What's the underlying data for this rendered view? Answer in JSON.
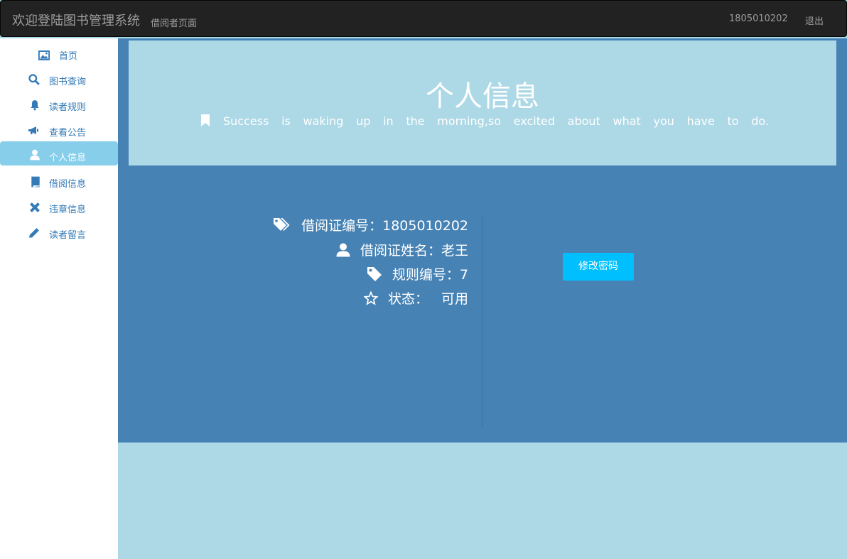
{
  "navbar": {
    "brand": "欢迎登陆图书管理系统",
    "subtitle": "借阅者页面",
    "user": "1805010202",
    "logout": "退出"
  },
  "sidebar": {
    "items": [
      {
        "label": "首页",
        "icon": "picture-icon"
      },
      {
        "label": "图书查询",
        "icon": "search-icon"
      },
      {
        "label": "读者规则",
        "icon": "bell-icon"
      },
      {
        "label": "查看公告",
        "icon": "bullhorn-icon"
      },
      {
        "label": "个人信息",
        "icon": "user-icon",
        "active": true
      },
      {
        "label": "借阅信息",
        "icon": "book-icon"
      },
      {
        "label": "违章信息",
        "icon": "remove-icon"
      },
      {
        "label": "读者留言",
        "icon": "pencil-icon"
      }
    ]
  },
  "jumbotron": {
    "title": "个人信息",
    "quote_words": [
      "Success",
      "is",
      "waking",
      "up",
      "in",
      "the",
      "morning,so",
      "excited",
      "about",
      "what",
      "you",
      "have",
      "to",
      "do."
    ]
  },
  "info": {
    "card_no": "借阅证编号：1805010202",
    "name": "借阅证姓名：老王",
    "rule_no": "规则编号：7",
    "status_label": "状态：",
    "status_value": "可用"
  },
  "actions": {
    "change_password": "修改密码"
  },
  "colors": {
    "accent": "#00bfff",
    "main_bg": "#4682b4",
    "light_bg": "#add8e6",
    "active_nav": "#87ceeb"
  }
}
